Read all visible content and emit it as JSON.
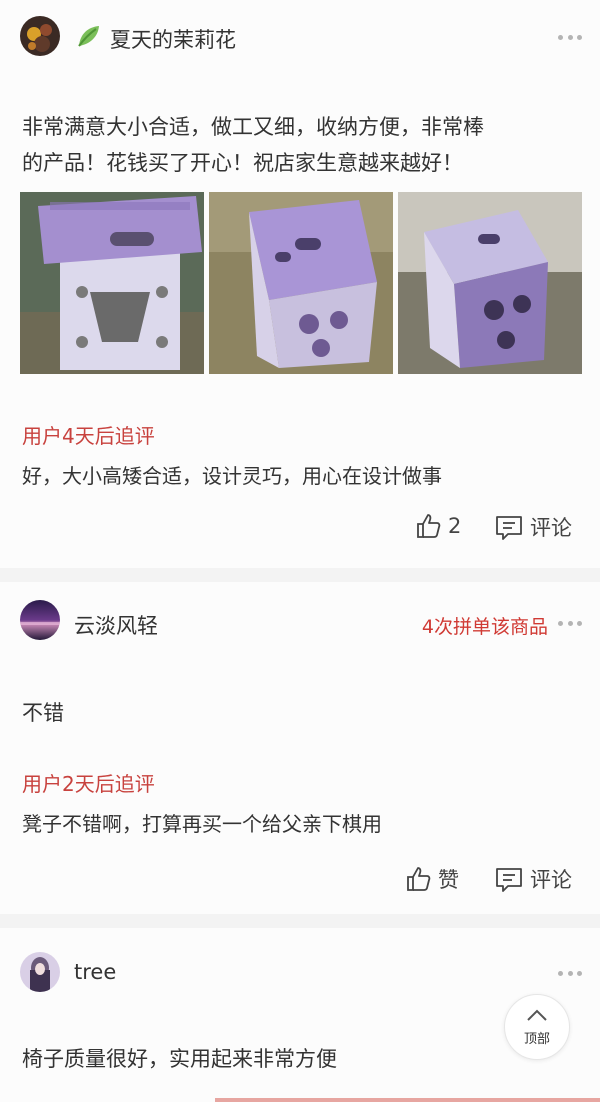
{
  "reviews": [
    {
      "username": "夏天的茉莉花",
      "text_line1": "非常满意大小合适，做工又细，收纳方便，非常棒",
      "text_line2": "的产品！花钱买了开心！祝店家生意越来越好！",
      "followup_title": "用户4天后追评",
      "followup_text": "好，大小高矮合适，设计灵巧，用心在设计做事",
      "like_label": "2",
      "comment_label": "评论",
      "photos": [
        "stool-photo-front",
        "stool-photo-angle",
        "stool-photo-side"
      ]
    },
    {
      "username": "云淡风轻",
      "tag": "4次拼单该商品",
      "text": "不错",
      "followup_title": "用户2天后追评",
      "followup_text": "凳子不错啊，打算再买一个给父亲下棋用",
      "like_label": "赞",
      "comment_label": "评论"
    },
    {
      "username": "tree",
      "text": "椅子质量很好，实用起来非常方便"
    }
  ],
  "scroll_top_label": "顶部",
  "icons": {
    "like": "thumbs-up-icon",
    "comment": "comment-icon",
    "more": "more-dots-icon",
    "leaf": "leaf-icon",
    "up": "chevron-up-icon"
  },
  "colors": {
    "accent_red": "#c8423e",
    "tag_red": "#d03a34"
  }
}
